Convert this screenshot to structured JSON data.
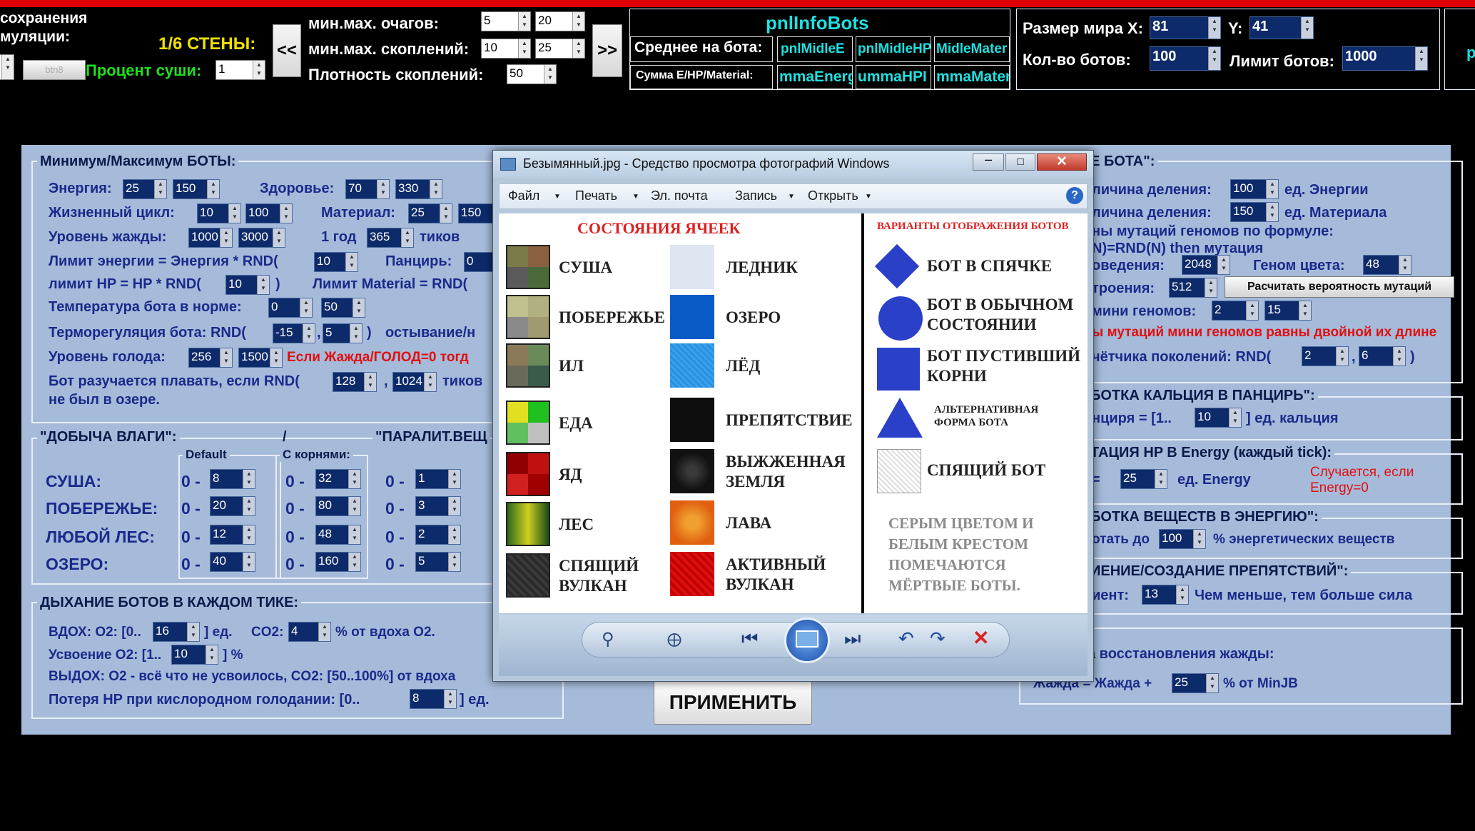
{
  "top": {
    "left_label1": "сохранения",
    "left_label2": "муляции:",
    "btn8": "btn8",
    "walls": "1/6 СТЕНЫ:",
    "dry_pct_label": "Процент суши:",
    "dry_pct": "1",
    "prev": "<<",
    "next": ">>",
    "minmax_foci_label": "мин.мах.  очагов:",
    "foci_min": "5",
    "foci_max": "20",
    "minmax_clusters_label": "мин.мах.  скоплений:",
    "clusters_min": "10",
    "clusters_max": "25",
    "density_label": "Плотность скоплений:",
    "density": "50",
    "info_title": "pnlInfoBots",
    "avg_label": "Среднее на бота:",
    "avg_cells": [
      "pnlMidleE",
      "pnlMidleHP",
      "MidleMater"
    ],
    "sum_label": "Сумма E/HP/Material:",
    "sum_cells": [
      "mmaEnerg",
      "ummaHPI",
      "mmaMater"
    ],
    "world_x_label": "Размер мира X:",
    "world_x": "81",
    "world_y_label": "Y:",
    "world_y": "41",
    "bots_count_label": "Кол-во ботов:",
    "bots_count": "100",
    "bots_limit_label": "Лимит ботов:",
    "bots_limit": "1000",
    "far_right": "p"
  },
  "left": {
    "group_title": "Минимум/Максимум БОТЫ:",
    "energy_label": "Энергия:",
    "energy_min": "25",
    "energy_max": "150",
    "health_label": "Здоровье:",
    "health_min": "70",
    "health_max": "330",
    "life_label": "Жизненный цикл:",
    "life_min": "10",
    "life_max": "100",
    "material_label": "Материал:",
    "material_min": "25",
    "material_max": "150",
    "thirst_label": "Уровень жажды:",
    "thirst_min": "1000",
    "thirst_max": "3000",
    "year_label": "1 год",
    "year_value": "365",
    "ticks_label": "тиков",
    "elimit_label": "Лимит энергии = Энергия * RND(",
    "elimit": "10",
    "armor_label": "Панцирь:",
    "armor": "0",
    "hplimit_label": "лимит HP = HP * RND(",
    "hplimit": "10",
    "matlimit_label": "Лимит Material = RND(",
    "temp_label": "Температура бота в норме:",
    "temp_min": "0",
    "temp_max": "50",
    "thermo_label": "Терморегуляция бота: RND(",
    "thermo_min": "-15",
    "thermo_max": "5",
    "cool_label": "остывание/н",
    "hunger_label": "Уровень голода:",
    "hunger_min": "256",
    "hunger_max": "1500",
    "hunger_note": "Если Жажда/ГОЛОД=0 тогд",
    "swim_label": "Бот разучается плавать, если RND(",
    "swim_min": "128",
    "swim_max": "1024",
    "swim_ticks": "тиков",
    "swim_label2": "не был в озере.",
    "moist_title": "\"ДОБЫЧА ВЛАГИ\":",
    "slash": "/",
    "paralit_title": "\"ПАРАЛИТ.ВЕЩ",
    "col_default": "Default",
    "col_roots": "С корнями:",
    "rows": [
      {
        "name": "СУША:",
        "prefix": "0 -",
        "d": "8",
        "r": "32",
        "p": "1"
      },
      {
        "name": "ПОБЕРЕЖЬЕ:",
        "prefix": "0 -",
        "d": "20",
        "r": "80",
        "p": "3"
      },
      {
        "name": "ЛЮБОЙ ЛЕС:",
        "prefix": "0 -",
        "d": "12",
        "r": "48",
        "p": "2"
      },
      {
        "name": "ОЗЕРО:",
        "prefix": "0 -",
        "d": "40",
        "r": "160",
        "p": "5"
      }
    ],
    "breath_title": "ДЫХАНИЕ БОТОВ В КАЖДОМ ТИКЕ:",
    "inhale_label": "ВДОХ: O2: [0..",
    "inhale": "16",
    "inhale_unit": "] ед.",
    "co2_label": "CO2:",
    "co2": "4",
    "co2_unit": "% от вдоха O2.",
    "absorb_label": "Усвоение O2: [1..",
    "absorb": "10",
    "absorb_unit": "] %",
    "exhale_label": "ВЫДОХ: O2 - всё что не усвоилось,   CO2: [50..100%] от вдоха",
    "hploss_label": "Потеря HP при кислородном голодании: [0..",
    "hploss": "8",
    "hploss_unit": "] ед."
  },
  "right": {
    "title1": "Е БОТА\":",
    "div_energy_label": "личина деления:",
    "div_energy": "100",
    "div_energy_unit": "ед. Энергии",
    "div_mat_label": "личина деления:",
    "div_mat": "150",
    "div_mat_unit": "ед. Материала",
    "mut_formula1": "ны мутаций геномов по формуле:",
    "mut_formula2": "N)=RND(N) then мутация",
    "behav_label": "оведения:",
    "behav": "2048",
    "color_genome_label": "Геном цвета:",
    "color_genome": "48",
    "struct_label": "троения:",
    "struct": "512",
    "calc_button": "Расчитать вероятность мутаций",
    "mini_label": "мини геномов:",
    "mini_min": "2",
    "mini_max": "15",
    "mini_note": "ы мутаций мини геномов равны двойной их длине",
    "gen_label": "чётчика поколений: RND(",
    "gen_min": "2",
    "gen_max": "6",
    "calcium_title": "БОТКА КАЛЬЦИЯ В ПАНЦИРЬ\":",
    "calcium_label": "нциря = [1..",
    "calcium": "10",
    "calcium_unit": "] ед. кальция",
    "hp_energy_title": "ТАЦИЯ HP В Energy (каждый tick):",
    "hp_energy_eq": "=",
    "hp_energy": "25",
    "hp_energy_unit": "ед. Energy",
    "hp_energy_note1": "Случается, если",
    "hp_energy_note2": "Energy=0",
    "subst_title": "БОТКА ВЕЩЕСТВ В ЭНЕРГИЮ\":",
    "subst_label": "отать до",
    "subst": "100",
    "subst_unit": "% энергетических веществ",
    "obst_title": "ИЕНИЕ/СОЗДАНИЕ ПРЕПЯТСТВИЙ\":",
    "obst_label": "иент:",
    "obst": "13",
    "obst_unit": "Чем меньше, тем больше сила",
    "restore_title": "а восстановления жажды:",
    "restore_label": "Жажда = Жажда +",
    "restore": "25",
    "restore_unit": "% от MinJB"
  },
  "apply_button": "ПРИМЕНИТЬ",
  "viewer": {
    "title": "Безымянный.jpg - Средство просмотра фотографий Windows",
    "menu": [
      "Файл",
      "Печать",
      "Эл. почта",
      "Запись",
      "Открыть"
    ],
    "img_title_left": "СОСТОЯНИЯ ЯЧЕЕК",
    "img_title_right": "ВАРИАНТЫ ОТОБРАЖЕНИЯ БОТОВ",
    "cells_left": [
      "СУША",
      "ПОБЕРЕЖЬЕ",
      "ИЛ",
      "ЕДА",
      "ЯД",
      "ЛЕС",
      "СПЯЩИЙ\nВУЛКАН"
    ],
    "cells_right": [
      "ЛЕДНИК",
      "ОЗЕРО",
      "ЛЁД",
      "ПРЕПЯТСТВИЕ",
      "ВЫЖЖЕННАЯ\nЗЕМЛЯ",
      "ЛАВА",
      "АКТИВНЫЙ\nВУЛКАН"
    ],
    "bots": [
      "БОТ В СПЯЧКЕ",
      "БОТ В ОБЫЧНОМ\nСОСТОЯНИИ",
      "БОТ ПУСТИВШИЙ\nКОРНИ",
      "АЛЬТЕРНАТИВНАЯ\nФОРМА БОТА",
      "СПЯЩИЙ БОТ"
    ],
    "dead_note": "СЕРЫМ ЦВЕТОМ И\nБЕЛЫМ КРЕСТОМ\nПОМЕЧАЮТСЯ\nМЁРТВЫЕ БОТЫ.",
    "behind_text": "ЖАЖДА"
  },
  "colors": {
    "accent_blue": "#1a2a8a",
    "panel": "#a6bbda",
    "alert_red": "#e01010",
    "cyan": "#20e0e0",
    "yellow": "#f0e000",
    "green": "#20e020"
  }
}
